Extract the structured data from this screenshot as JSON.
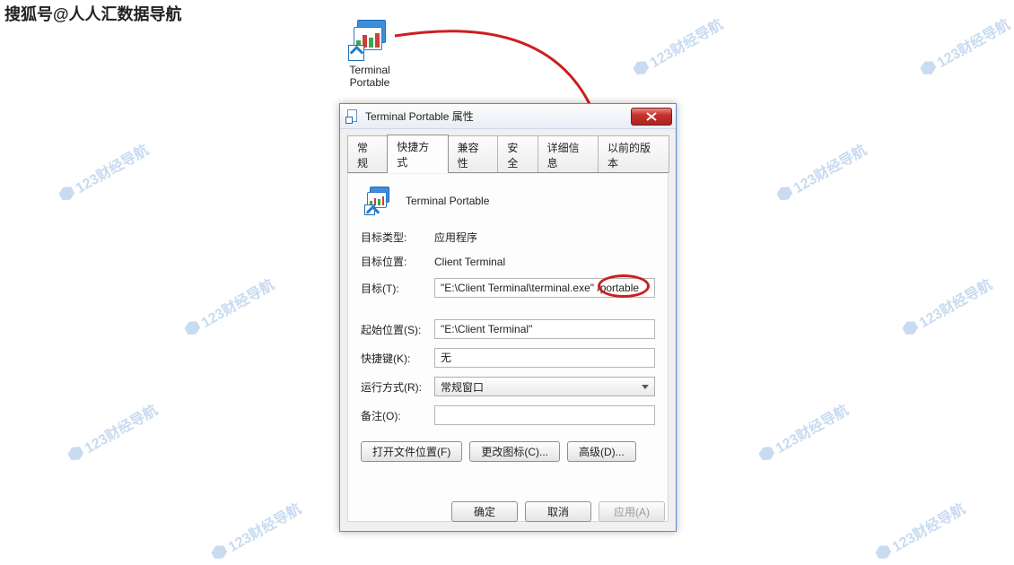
{
  "watermark_text": "123财经导航",
  "top_note": "搜狐号@人人汇数据导航",
  "desktop_icon": {
    "label_line1": "Terminal",
    "label_line2": "Portable"
  },
  "dialog": {
    "title": "Terminal Portable 属性",
    "tabs": [
      "常规",
      "快捷方式",
      "兼容性",
      "安全",
      "详细信息",
      "以前的版本"
    ],
    "active_tab_index": 1,
    "app_name": "Terminal Portable",
    "labels": {
      "target_type": "目标类型:",
      "target_location": "目标位置:",
      "target": "目标(T):",
      "start_in": "起始位置(S):",
      "shortcut_key": "快捷键(K):",
      "run": "运行方式(R):",
      "comment": "备注(O):"
    },
    "values": {
      "target_type": "应用程序",
      "target_location": "Client Terminal",
      "target": "\"E:\\Client Terminal\\terminal.exe\" /portable",
      "start_in": "\"E:\\Client Terminal\"",
      "shortcut_key": "无",
      "run": "常规窗口",
      "comment": ""
    },
    "buttons": {
      "open_file_location": "打开文件位置(F)",
      "change_icon": "更改图标(C)...",
      "advanced": "高级(D)..."
    },
    "bottom": {
      "ok": "确定",
      "cancel": "取消",
      "apply": "应用(A)"
    }
  }
}
